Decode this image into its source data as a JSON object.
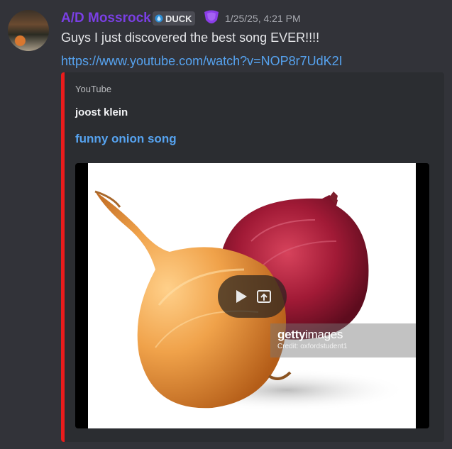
{
  "message": {
    "username": "A/D Mossrock",
    "username_color": "#7a3fe4",
    "tag": {
      "icon": "water-drop-icon",
      "label": "DUCK"
    },
    "role_icon": "purple-badge-icon",
    "timestamp": "1/25/25, 4:21 PM",
    "text": "Guys I just discovered the best song EVER!!!!",
    "link": "https://www.youtube.com/watch?v=NOP8r7UdK2I"
  },
  "embed": {
    "accent_color": "#ea1c1c",
    "provider": "YouTube",
    "author": "joost klein",
    "title": "funny onion song",
    "thumbnail": {
      "description_icon": "onion-image",
      "watermark_logo_bold": "getty",
      "watermark_logo_light": "images",
      "watermark_credit": "Credit: oxfordstudent1"
    },
    "controls": {
      "play_icon": "play-icon",
      "popout_icon": "popout-icon"
    }
  },
  "colors": {
    "background": "#323339",
    "embed_bg": "#2b2d31",
    "link": "#56a3f0"
  }
}
